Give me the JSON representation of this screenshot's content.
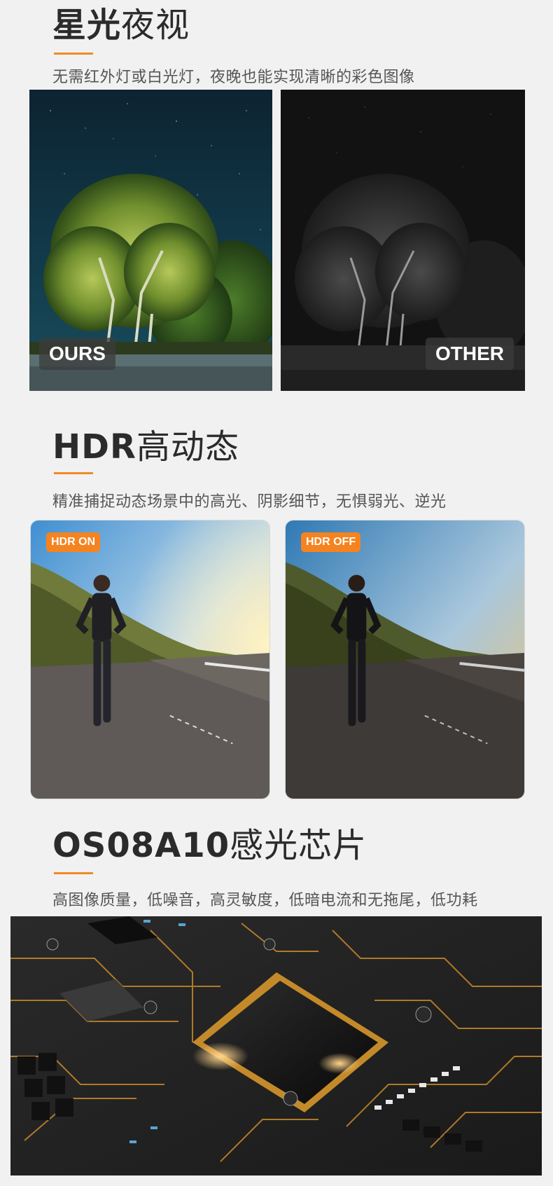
{
  "night": {
    "title_bold": "星光",
    "title_rest": "夜视",
    "subtitle": "无需红外灯或白光灯，夜晚也能实现清晰的彩色图像",
    "tag_left": "OURS",
    "tag_right": "OTHER"
  },
  "hdr": {
    "title_bold": "HDR",
    "title_rest": "高动态",
    "subtitle": "精准捕捉动态场景中的高光、阴影细节，无惧弱光、逆光",
    "tag_left": "HDR ON",
    "tag_right": "HDR OFF"
  },
  "sensor": {
    "title_bold": "OS08A10",
    "title_rest": "感光芯片",
    "subtitle": "高图像质量，低噪音，高灵敏度，低暗电流和无拖尾，低功耗"
  },
  "colors": {
    "accent": "#f08a24",
    "tag_orange": "#f5831f",
    "background": "#f1f1f1"
  }
}
